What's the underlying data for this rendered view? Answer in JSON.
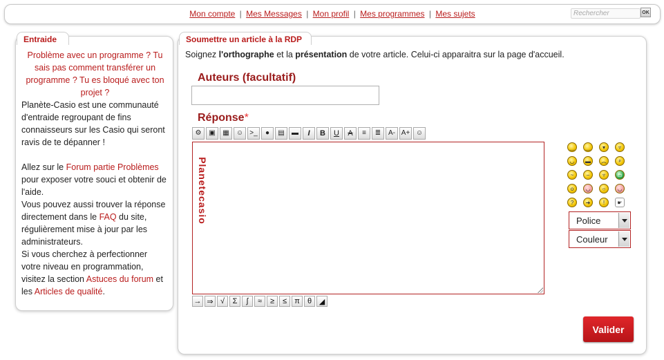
{
  "topnav": {
    "links": [
      "Mon compte",
      "Mes Messages",
      "Mon profil",
      "Mes programmes",
      "Mes sujets"
    ],
    "separator": "|",
    "search_placeholder": "Rechercher",
    "search_button": "OK"
  },
  "aside": {
    "title": "Entraide",
    "intro": "Problème avec un programme ? Tu sais pas comment transférer un programme ? Tu es bloqué avec ton projet ?",
    "para1": "Planète-Casio est une communauté d'entraide regroupant de fins connaisseurs sur les Casio qui seront ravis de te dépanner !",
    "para2_pre": "Allez sur le ",
    "para2_link": "Forum partie Problèmes",
    "para2_post": " pour exposer votre souci et obtenir de l'aide.",
    "para3_pre": "Vous pouvez aussi trouver la réponse directement dans le ",
    "para3_link": "FAQ",
    "para3_post": " du site, régulièrement mise à jour par les administrateurs.",
    "para4_pre": "Si vous cherchez à perfectionner votre niveau en programmation, visitez la section ",
    "para4_link1": "Astuces du forum",
    "para4_mid": " et les ",
    "para4_link2": "Articles de qualité",
    "para4_post": "."
  },
  "main": {
    "title": "Soumettre un article à la RDP",
    "instr_pre": "Soignez ",
    "instr_b1": "l'orthographe",
    "instr_mid": " et la ",
    "instr_b2": "présentation",
    "instr_post": " de votre article. Celui-ci apparaitra sur la page d'accueil.",
    "authors_label": "Auteurs (facultatif)",
    "authors_value": "",
    "response_label": "Réponse",
    "required_mark": "*",
    "editor_watermark": "Planetecasio",
    "toolbar": [
      "⚙",
      "▣",
      "▦",
      "☺",
      ">_",
      "●",
      "▤",
      "▬",
      "I",
      "B",
      "U",
      "A",
      "≡",
      "≣",
      "A-",
      "A+",
      "☺"
    ],
    "math_toolbar": [
      "→",
      "⇒",
      "√",
      "Σ",
      "∫",
      "≈",
      "≥",
      "≤",
      "π",
      "θ",
      "◢"
    ],
    "smileys": [
      "🙂",
      "🙂",
      "😄",
      "😃",
      "😉",
      "😎",
      "🙁",
      "😛",
      "😵",
      "😐",
      "😈",
      "😁",
      "😮",
      "😊",
      "😨",
      "🎅",
      "?",
      "➜",
      "!",
      "☛"
    ],
    "police": "Police",
    "couleur": "Couleur",
    "submit": "Valider"
  }
}
